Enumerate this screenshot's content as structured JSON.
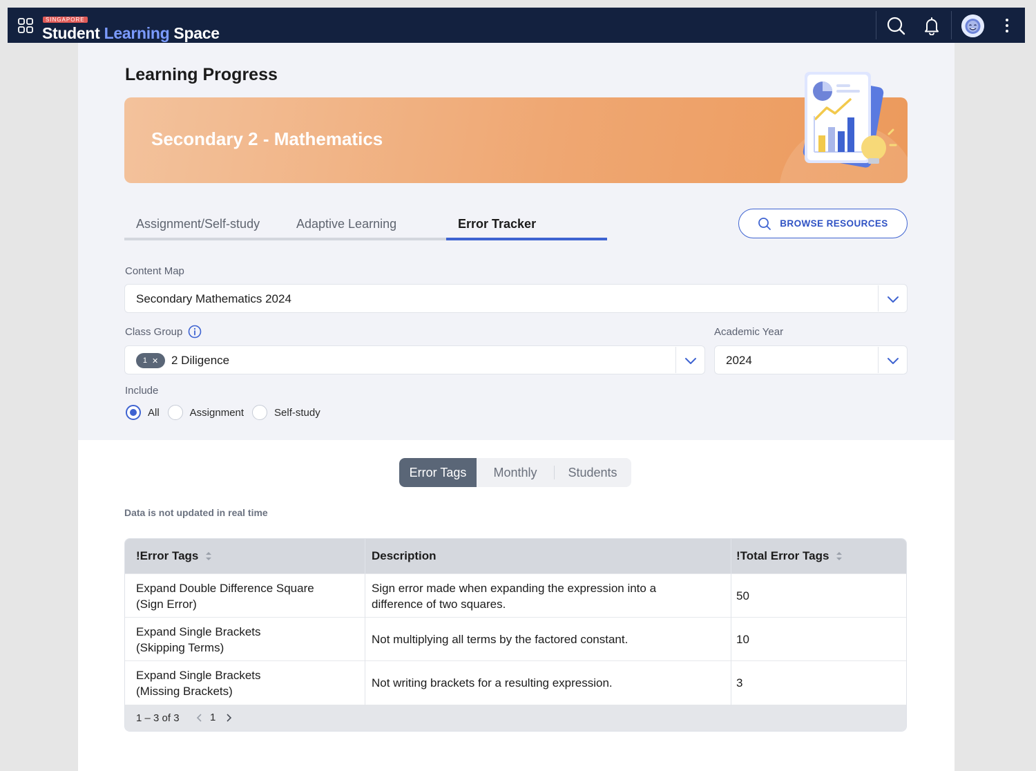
{
  "brand": {
    "tag": "SINGAPORE",
    "name_part1": "Student",
    "name_part2": "Learning",
    "name_part3": "Space"
  },
  "page": {
    "title": "Learning Progress"
  },
  "banner": {
    "title": "Secondary 2 - Mathematics"
  },
  "tabs": [
    {
      "label": "Assignment/Self-study"
    },
    {
      "label": "Adaptive Learning"
    },
    {
      "label": "Error Tracker",
      "active": true
    }
  ],
  "browse_button": {
    "label": "BROWSE RESOURCES"
  },
  "filters": {
    "content_map": {
      "label": "Content Map",
      "value": "Secondary Mathematics 2024"
    },
    "class_group": {
      "label": "Class Group",
      "chip_count": "1",
      "value": "2 Diligence"
    },
    "academic_year": {
      "label": "Academic Year",
      "value": "2024"
    },
    "include": {
      "label": "Include",
      "options": [
        "All",
        "Assignment",
        "Self-study"
      ],
      "selected": "All"
    }
  },
  "views": {
    "options": [
      "Error Tags",
      "Monthly",
      "Students"
    ],
    "selected": "Error Tags"
  },
  "note": "Data is not updated in real time",
  "table": {
    "headers": [
      "!Error Tags",
      "Description",
      "!Total Error Tags"
    ],
    "rows": [
      {
        "tag_line1": "Expand Double Difference Square",
        "tag_line2": "(Sign Error)",
        "desc_line1": "Sign error made when expanding the expression into a",
        "desc_line2": "difference of two squares.",
        "total": "50"
      },
      {
        "tag_line1": "Expand Single Brackets",
        "tag_line2": "(Skipping Terms)",
        "desc_line1": "Not multiplying all terms by the factored constant.",
        "desc_line2": "",
        "total": "10"
      },
      {
        "tag_line1": "Expand Single Brackets",
        "tag_line2": "(Missing Brackets)",
        "desc_line1": "Not writing brackets for a resulting expression.",
        "desc_line2": "",
        "total": "3"
      }
    ],
    "pagination": {
      "range": "1 – 3 of 3",
      "page": "1"
    }
  },
  "colors": {
    "navbar": "#13213f",
    "accent": "#3e63d1",
    "banner": "#efa772"
  },
  "icons": [
    "apps-grid-icon",
    "search-icon",
    "bell-icon",
    "avatar",
    "more-vertical-icon",
    "info-icon",
    "chevron-down-icon",
    "sort-icon",
    "chevron-left-icon",
    "chevron-right-icon"
  ]
}
